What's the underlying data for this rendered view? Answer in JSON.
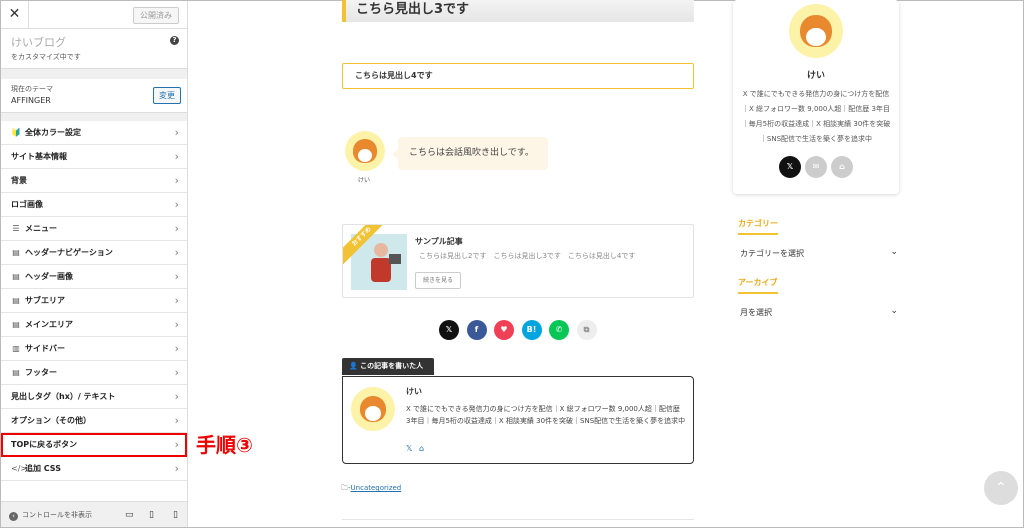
{
  "sidebar": {
    "close": "✕",
    "publish": "公開済み",
    "site_name": "けいブログ",
    "site_sub": "をカスタマイズ中です",
    "help": "?",
    "theme_label": "現在のテーマ",
    "theme_name": "AFFINGER",
    "change": "変更",
    "items": [
      {
        "icon": "🔰",
        "label": "全体カラー設定"
      },
      {
        "icon": "",
        "label": "サイト基本情報"
      },
      {
        "icon": "",
        "label": "背景"
      },
      {
        "icon": "",
        "label": "ロゴ画像"
      },
      {
        "icon": "☰",
        "label": "メニュー"
      },
      {
        "icon": "▤",
        "label": "ヘッダーナビゲーション"
      },
      {
        "icon": "▤",
        "label": "ヘッダー画像"
      },
      {
        "icon": "▤",
        "label": "サブエリア"
      },
      {
        "icon": "▤",
        "label": "メインエリア"
      },
      {
        "icon": "▥",
        "label": "サイドバー"
      },
      {
        "icon": "▤",
        "label": "フッター"
      },
      {
        "icon": "",
        "label": "見出しタグ（hx）/ テキスト"
      },
      {
        "icon": "",
        "label": "オプション（その他）"
      },
      {
        "icon": "",
        "label": "TOPに戻るボタン"
      },
      {
        "icon": "</>",
        "label": "追加 CSS"
      }
    ],
    "hide_controls": "コントロールを非表示"
  },
  "annotation": "手順③",
  "main": {
    "h3": "こちら見出し3です",
    "h4": "こちらは見出し4です",
    "chat_name": "けい",
    "chat_text": "こちらは会話風吹き出しです。",
    "card": {
      "ribbon": "おすすめ",
      "title": "サンプル記事",
      "excerpt": "こちらは見出し2です　こちらは見出し3です　こちらは見出し4です",
      "button": "続きを見る"
    },
    "share": [
      {
        "name": "x",
        "glyph": "𝕏",
        "color": "#111111"
      },
      {
        "name": "facebook",
        "glyph": "f",
        "color": "#3b5998"
      },
      {
        "name": "pocket",
        "glyph": "♥",
        "color": "#ef4056"
      },
      {
        "name": "hatena",
        "glyph": "B!",
        "color": "#00a4de"
      },
      {
        "name": "line",
        "glyph": "✆",
        "color": "#06c755"
      },
      {
        "name": "copy",
        "glyph": "⧉",
        "color": "#eeeeee"
      }
    ],
    "writer_tab": "この記事を書いた人",
    "writer_name": "けい",
    "writer_bio": "X で誰にでもできる発信力の身につけ方を配信｜X 総フォロワー数 9,000人超｜配信歴 3年目｜毎月5桁の収益達成｜X 相談実績 30件を突破｜SNS配信で生活を築く夢を追求中",
    "writer_icons": {
      "x": "𝕏",
      "home": "⌂"
    },
    "category_link": "Uncategorized"
  },
  "right": {
    "name": "けい",
    "bio": "X で誰にでもできる発信力の身につけ方を配信｜X 総フォロワー数 9,000人超｜配信歴 3年目｜毎月5桁の収益達成｜X 相談実績 30件を突破｜SNS配信で生活を築く夢を追求中",
    "icons": [
      {
        "glyph": "𝕏",
        "color": "#111111"
      },
      {
        "glyph": "✉",
        "color": "#cccccc"
      },
      {
        "glyph": "⌂",
        "color": "#cccccc"
      }
    ],
    "category_head": "カテゴリー",
    "category_select": "カテゴリーを選択",
    "archive_head": "アーカイブ",
    "archive_select": "月を選択"
  },
  "colors": {
    "accent": "#f1c232",
    "highlight": "#e00000",
    "link": "#2271b1"
  }
}
